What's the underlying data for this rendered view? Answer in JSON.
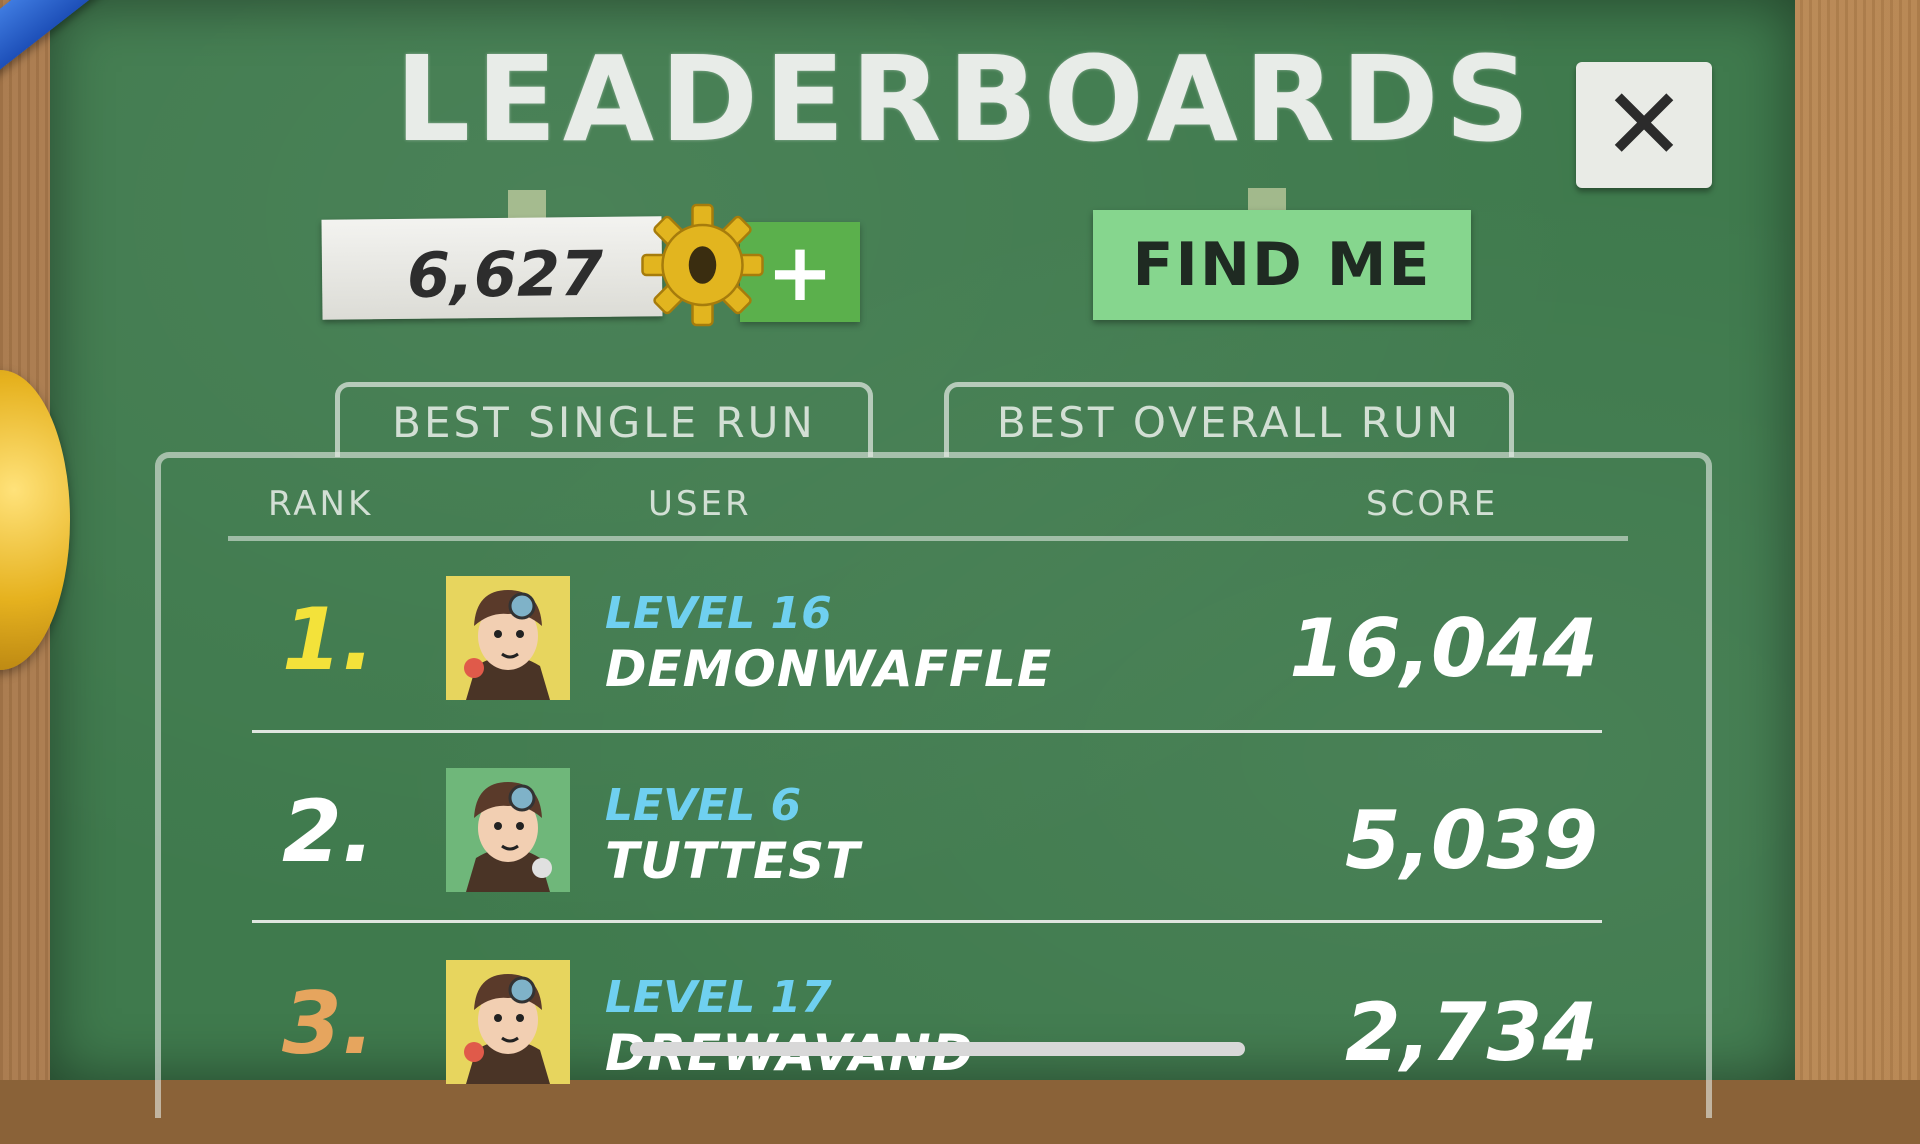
{
  "header": {
    "title": "LEADERBOARDS",
    "close_label": "✕"
  },
  "currency": {
    "value": "6,627",
    "add_label": "+",
    "icon": "gear-coin-icon"
  },
  "find_me_label": "FIND ME",
  "tabs": [
    {
      "label": "BEST SINGLE RUN",
      "selected": true
    },
    {
      "label": "BEST OVERALL RUN",
      "selected": false
    }
  ],
  "columns": {
    "rank": "RANK",
    "user": "USER",
    "score": "SCORE"
  },
  "entries": [
    {
      "rank": "1.",
      "level": "LEVEL 16",
      "name": "DEMONWAFFLE",
      "score": "16,044",
      "rank_color": "#f3e23a"
    },
    {
      "rank": "2.",
      "level": "LEVEL 6",
      "name": "TUTTEST",
      "score": "5,039",
      "rank_color": "#ffffff"
    },
    {
      "rank": "3.",
      "level": "LEVEL 17",
      "name": "DREWAVAND",
      "score": "2,734",
      "rank_color": "#e6a55e"
    }
  ],
  "colors": {
    "board": "#3f7a4d",
    "level_text": "#6fd0f0",
    "find_me": "#86d68e",
    "add": "#5bb04c"
  }
}
